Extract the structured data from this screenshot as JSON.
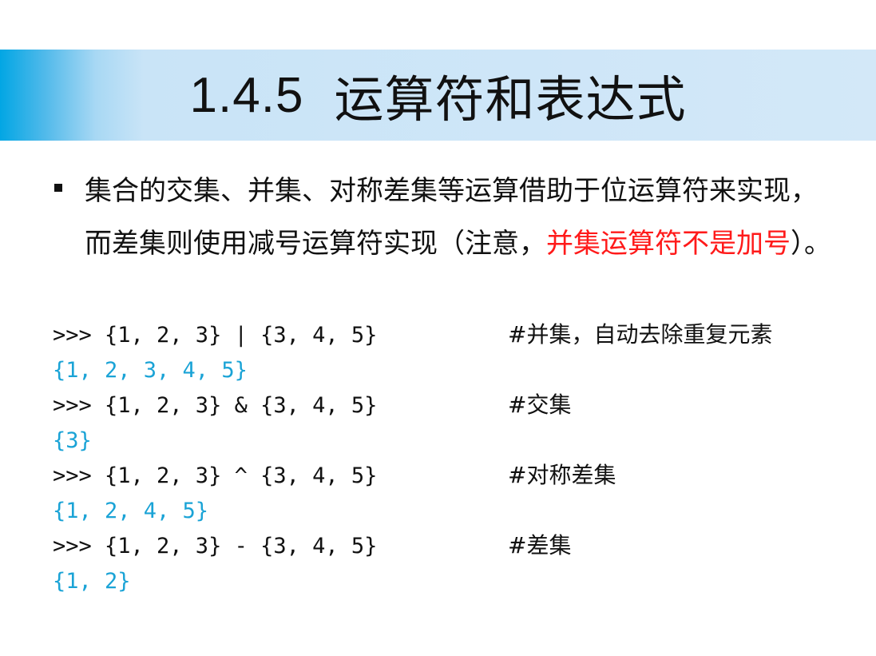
{
  "slide": {
    "title_number": "1.4.5",
    "title_text": "运算符和表达式"
  },
  "bullet": {
    "text_before": "集合的交集、并集、对称差集等运算借助于位运算符来实现，而差集则使用减号运算符实现（注意，",
    "text_red": "并集运算符不是加号",
    "text_after": "）。"
  },
  "code": [
    {
      "input": ">>> {1, 2, 3} | {3, 4, 5}",
      "comment": "#并集，自动去除重复元素",
      "output": "{1, 2, 3, 4, 5}"
    },
    {
      "input": ">>> {1, 2, 3} & {3, 4, 5}",
      "comment": "#交集",
      "output": "{3}"
    },
    {
      "input": ">>> {1, 2, 3} ^ {3, 4, 5}",
      "comment": "#对称差集",
      "output": "{1, 2, 4, 5}"
    },
    {
      "input": ">>> {1, 2, 3} - {3, 4, 5}",
      "comment": "#差集",
      "output": "{1, 2}"
    }
  ],
  "colors": {
    "title_bar_start": "#02a6e4",
    "title_bar_end": "#d3e8f8",
    "highlight": "#ff1a1a",
    "output": "#1aa3d6"
  }
}
